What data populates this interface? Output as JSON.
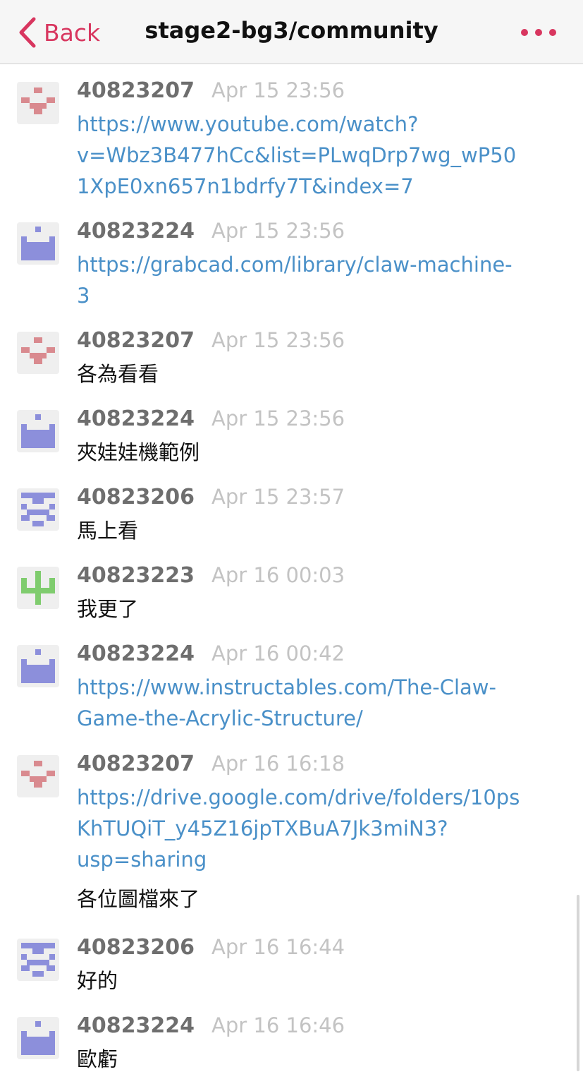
{
  "header": {
    "back_label": "Back",
    "title": "stage2-bg3/community",
    "back_icon": "chevron-left-icon",
    "more_icon": "more-dots-icon"
  },
  "colors": {
    "accent": "#d8365f",
    "link": "#4a90c8",
    "author": "#6e6e6e",
    "timestamp": "#c3c3c3",
    "avatar_red": "#d98a8f",
    "avatar_purple": "#8c8fdb",
    "avatar_green": "#7fcc6e"
  },
  "messages": [
    {
      "author": "40823207",
      "time": "Apr 15 23:56",
      "lines": [
        {
          "text": "https://www.youtube.com/watch?",
          "link": true
        },
        {
          "text": "v=Wbz3B477hCc&list=PLwqDrp7wg_wP50",
          "link": true
        },
        {
          "text": "1XpE0xn657n1bdrfy7T&index=7",
          "link": true
        }
      ]
    },
    {
      "author": "40823224",
      "time": "Apr 15 23:56",
      "lines": [
        {
          "text": "https://grabcad.com/library/claw-machine-",
          "link": true
        },
        {
          "text": "3",
          "link": true
        }
      ]
    },
    {
      "author": "40823207",
      "time": "Apr 15 23:56",
      "lines": [
        {
          "text": "各為看看",
          "link": false
        }
      ]
    },
    {
      "author": "40823224",
      "time": "Apr 15 23:56",
      "lines": [
        {
          "text": "夾娃娃機範例",
          "link": false
        }
      ]
    },
    {
      "author": "40823206",
      "time": "Apr 15 23:57",
      "lines": [
        {
          "text": "馬上看",
          "link": false
        }
      ]
    },
    {
      "author": "40823223",
      "time": "Apr 16 00:03",
      "lines": [
        {
          "text": "我更了",
          "link": false
        }
      ]
    },
    {
      "author": "40823224",
      "time": "Apr 16 00:42",
      "lines": [
        {
          "text": "https://www.instructables.com/The-Claw-",
          "link": true
        },
        {
          "text": "Game-the-Acrylic-Structure/",
          "link": true
        }
      ]
    },
    {
      "author": "40823207",
      "time": "Apr 16 16:18",
      "lines": [
        {
          "text": "https://drive.google.com/drive/folders/10ps",
          "link": true
        },
        {
          "text": "KhTUQiT_y45Z16jpTXBuA7Jk3miN3?",
          "link": true
        },
        {
          "text": "usp=sharing",
          "link": true
        },
        {
          "text": "各位圖檔來了",
          "link": false
        }
      ]
    },
    {
      "author": "40823206",
      "time": "Apr 16 16:44",
      "lines": [
        {
          "text": "好的",
          "link": false
        }
      ]
    },
    {
      "author": "40823224",
      "time": "Apr 16 16:46",
      "lines": [
        {
          "text": "歐虧",
          "link": false
        }
      ]
    }
  ]
}
